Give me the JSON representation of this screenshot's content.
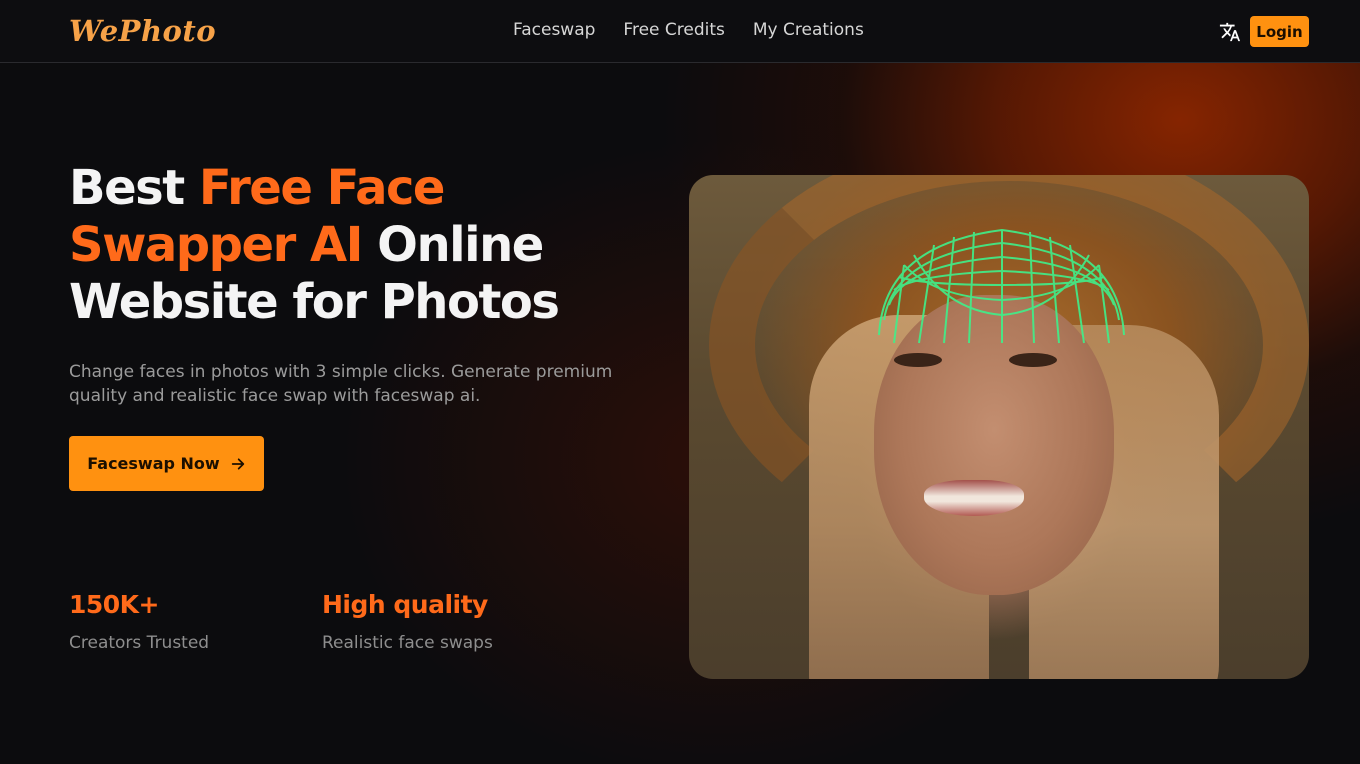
{
  "brand": {
    "logo": "WePhoto",
    "accent_color": "#ff6a1a",
    "button_color": "#ff9110"
  },
  "nav": {
    "links": [
      "Faceswap",
      "Free Credits",
      "My Creations"
    ],
    "language_icon": "translate-icon",
    "login_label": "Login"
  },
  "hero": {
    "title_part1": "Best ",
    "title_accent": "Free Face Swapper AI",
    "title_part2": " Online Website for Photos",
    "subtitle": "Change faces in photos with 3 simple clicks. Generate premium quality and realistic face swap with faceswap ai.",
    "cta_label": "Faceswap Now",
    "cta_icon": "arrow-right-icon"
  },
  "stats": [
    {
      "value": "150K+",
      "label": "Creators Trusted"
    },
    {
      "value": "High quality",
      "label": "Realistic face swaps"
    }
  ],
  "image": {
    "mesh_color": "#3ff08a"
  }
}
